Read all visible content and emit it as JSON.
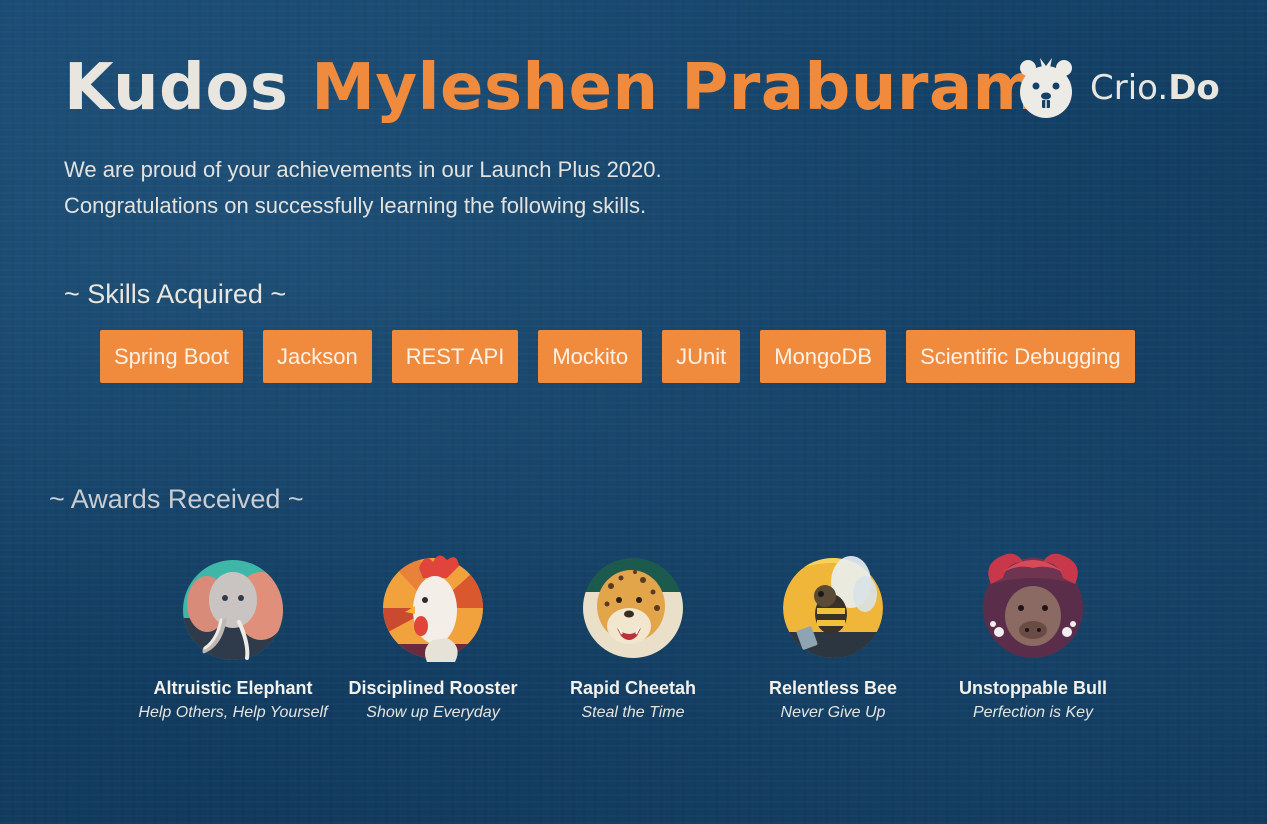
{
  "header": {
    "title_prefix": "Kudos",
    "recipient_name": "Myleshen Praburam",
    "logo_text": "Crio.",
    "logo_text_bold": "Do",
    "logo_icon": "beaver-icon"
  },
  "intro": {
    "line1": "We are proud of your achievements in our Launch Plus 2020.",
    "line2": "Congratulations on successfully learning the following skills."
  },
  "skills": {
    "heading": "~ Skills Acquired ~",
    "items": [
      "Spring Boot",
      "Jackson",
      "REST API",
      "Mockito",
      "JUnit",
      "MongoDB",
      "Scientific Debugging"
    ]
  },
  "awards": {
    "heading": "~ Awards Received ~",
    "items": [
      {
        "name": "Altruistic Elephant",
        "motto": "Help Others, Help Yourself",
        "icon": "elephant-icon"
      },
      {
        "name": "Disciplined Rooster",
        "motto": "Show up Everyday",
        "icon": "rooster-icon"
      },
      {
        "name": "Rapid Cheetah",
        "motto": "Steal the Time",
        "icon": "cheetah-icon"
      },
      {
        "name": "Relentless Bee",
        "motto": "Never Give Up",
        "icon": "bee-icon"
      },
      {
        "name": "Unstoppable Bull",
        "motto": "Perfection is Key",
        "icon": "bull-icon"
      }
    ]
  },
  "colors": {
    "accent": "#f08a3c",
    "background": "#143f66",
    "text": "#e9e6df"
  }
}
